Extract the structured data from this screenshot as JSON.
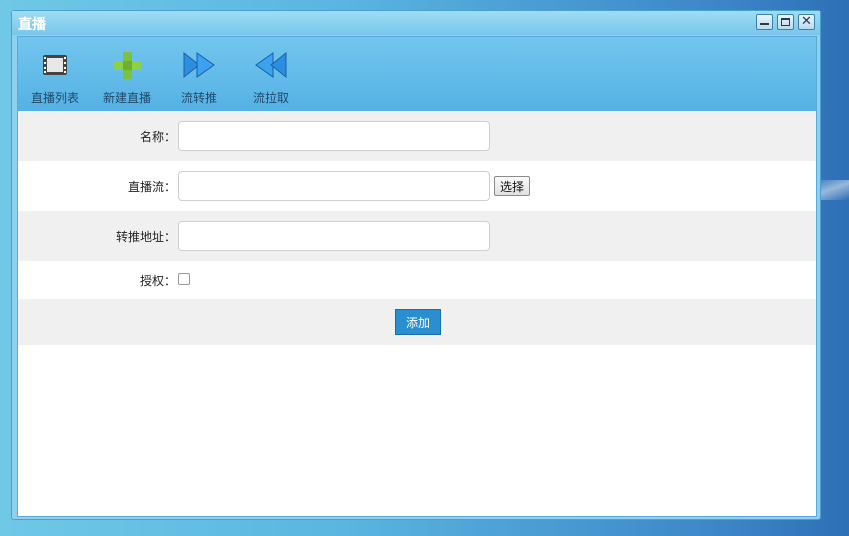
{
  "window": {
    "title": "直播"
  },
  "toolbar": {
    "items": [
      {
        "label": "直播列表",
        "icon": "film-icon"
      },
      {
        "label": "新建直播",
        "icon": "plus-icon"
      },
      {
        "label": "流转推",
        "icon": "fast-forward-icon"
      },
      {
        "label": "流拉取",
        "icon": "rewind-icon"
      }
    ]
  },
  "form": {
    "name_label": "名称：",
    "stream_label": "直播流：",
    "choose_button": "选择",
    "forward_label": "转推地址：",
    "auth_label": "授权：",
    "name_value": "",
    "stream_value": "",
    "forward_value": "",
    "auth_checked": false,
    "submit_button": "添加"
  },
  "colors": {
    "accent": "#2a8fd0",
    "toolbar": "#62bbea",
    "row_shade": "#f0f0f0"
  }
}
